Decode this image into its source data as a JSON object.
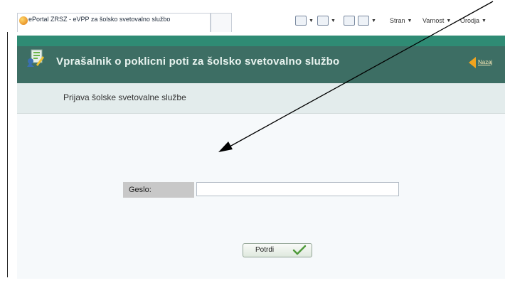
{
  "browser": {
    "tab_title": "ePortal ZRSZ - eVPP za šolsko svetovalno službo",
    "toolbar": {
      "page_menu": "Stran",
      "safety_menu": "Varnost",
      "tools_menu": "Orodja"
    }
  },
  "header": {
    "title": "Vprašalnik o poklicni poti za šolsko svetovalno službo",
    "back_link": "Nazaj"
  },
  "subheader": {
    "title": "Prijava šolske svetovalne službe"
  },
  "form": {
    "password_label": "Geslo:",
    "password_value": "",
    "submit_label": "Potrdi"
  },
  "colors": {
    "header_bg": "#3d6e64",
    "accent_strip": "#2f8b74",
    "subheader_bg": "#e3ecec",
    "back_icon": "#f0a41e"
  }
}
